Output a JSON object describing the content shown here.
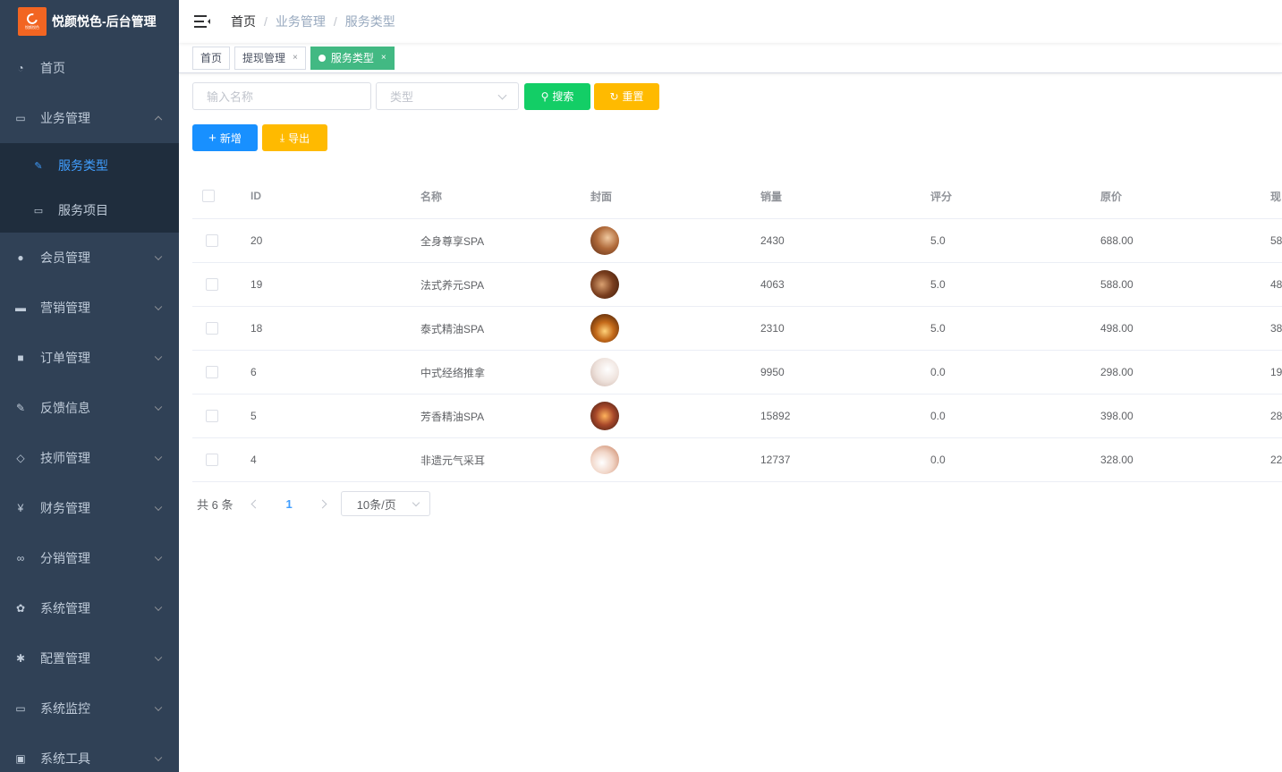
{
  "app": {
    "title": "悦颜悦色-后台管理",
    "logo_text": "悦颜悦色"
  },
  "sidebar": {
    "items": [
      {
        "label": "首页",
        "icon": "dashboard-icon"
      },
      {
        "label": "业务管理",
        "icon": "monitor-icon",
        "expanded": true,
        "children": [
          {
            "label": "服务类型",
            "icon": "edit-icon",
            "active": true
          },
          {
            "label": "服务项目",
            "icon": "monitor-icon"
          }
        ]
      },
      {
        "label": "会员管理",
        "icon": "peoples-icon"
      },
      {
        "label": "营销管理",
        "icon": "board-icon"
      },
      {
        "label": "订单管理",
        "icon": "lock-icon"
      },
      {
        "label": "反馈信息",
        "icon": "edit-icon"
      },
      {
        "label": "技师管理",
        "icon": "tag-icon"
      },
      {
        "label": "财务管理",
        "icon": "money-icon"
      },
      {
        "label": "分销管理",
        "icon": "share-icon"
      },
      {
        "label": "系统管理",
        "icon": "settings-icon"
      },
      {
        "label": "配置管理",
        "icon": "gear-icon"
      },
      {
        "label": "系统监控",
        "icon": "monitor-icon"
      },
      {
        "label": "系统工具",
        "icon": "toolbox-icon"
      }
    ]
  },
  "breadcrumb": [
    "首页",
    "业务管理",
    "服务类型"
  ],
  "tags": [
    {
      "label": "首页",
      "closable": false,
      "active": false
    },
    {
      "label": "提现管理",
      "closable": true,
      "active": false
    },
    {
      "label": "服务类型",
      "closable": true,
      "active": true
    }
  ],
  "filters": {
    "name_placeholder": "输入名称",
    "type_placeholder": "类型",
    "search_label": "搜索",
    "reset_label": "重置"
  },
  "actions": {
    "add_label": "新增",
    "export_label": "导出"
  },
  "table": {
    "columns": [
      "ID",
      "名称",
      "封面",
      "销量",
      "评分",
      "原价",
      "现"
    ],
    "rows": [
      {
        "id": "20",
        "name": "全身尊享SPA",
        "sales": "2430",
        "score": "5.0",
        "price": "688.00",
        "now": "58"
      },
      {
        "id": "19",
        "name": "法式养元SPA",
        "sales": "4063",
        "score": "5.0",
        "price": "588.00",
        "now": "48"
      },
      {
        "id": "18",
        "name": "泰式精油SPA",
        "sales": "2310",
        "score": "5.0",
        "price": "498.00",
        "now": "38"
      },
      {
        "id": "6",
        "name": "中式经络推拿",
        "sales": "9950",
        "score": "0.0",
        "price": "298.00",
        "now": "19"
      },
      {
        "id": "5",
        "name": "芳香精油SPA",
        "sales": "15892",
        "score": "0.0",
        "price": "398.00",
        "now": "28"
      },
      {
        "id": "4",
        "name": "非遗元气采耳",
        "sales": "12737",
        "score": "0.0",
        "price": "328.00",
        "now": "22"
      }
    ]
  },
  "pagination": {
    "total": "共 6 条",
    "current": "1",
    "page_size": "10条/页"
  },
  "colors": {
    "sidebar": "#304156",
    "active": "#409eff",
    "tag_active": "#42b983",
    "success": "#13ce66",
    "warning": "#ffba00",
    "primary": "#1890ff"
  }
}
